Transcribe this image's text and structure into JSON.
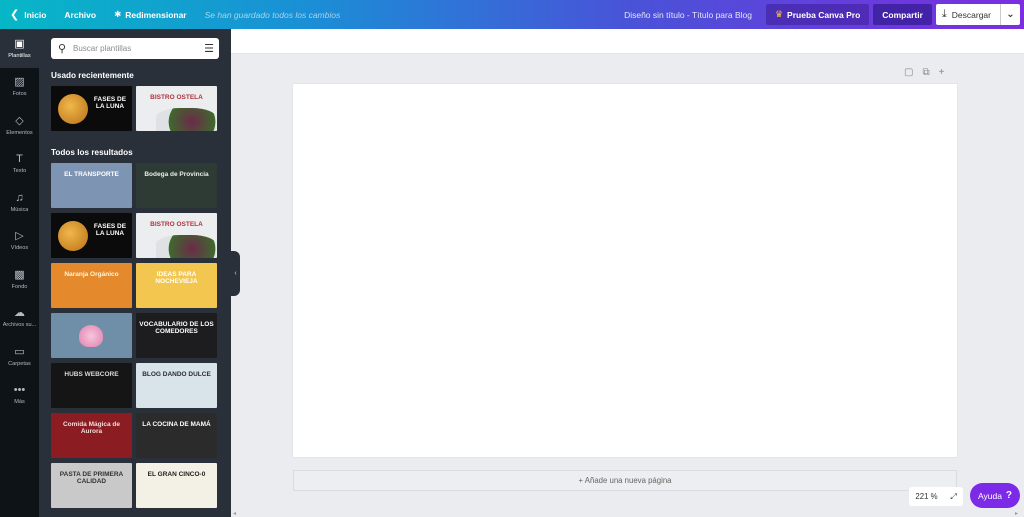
{
  "topbar": {
    "home_label": "Inicio",
    "file_label": "Archivo",
    "resize_label": "Redimensionar",
    "saved_status": "Se han guardado todos los cambios",
    "doc_title": "Diseño sin título - Título para Blog",
    "pro_label": "Prueba Canva Pro",
    "share_label": "Compartir",
    "download_label": "Descargar"
  },
  "rail": {
    "items": [
      {
        "label": "Plantillas",
        "icon": "▣"
      },
      {
        "label": "Fotos",
        "icon": "▨"
      },
      {
        "label": "Elementos",
        "icon": "◇"
      },
      {
        "label": "Texto",
        "icon": "T"
      },
      {
        "label": "Música",
        "icon": "♫"
      },
      {
        "label": "Vídeos",
        "icon": "▷"
      },
      {
        "label": "Fondo",
        "icon": "▩"
      },
      {
        "label": "Archivos su...",
        "icon": "☁"
      },
      {
        "label": "Carpetas",
        "icon": "▭"
      },
      {
        "label": "Más",
        "icon": "•••"
      }
    ]
  },
  "panel": {
    "search_placeholder": "Buscar plantillas",
    "recent_title": "Usado recientemente",
    "all_title": "Todos los resultados",
    "recent": [
      {
        "text": "FASES DE LA LUNA",
        "bg": "#0b0b0b",
        "fg": "#ffffff",
        "moon": true
      },
      {
        "text": "BISTRO OSTELA",
        "bg": "#ecedef",
        "fg": "#b1333c",
        "food": true
      }
    ],
    "results": [
      {
        "text": "EL TRANSPORTE",
        "bg": "#7d95b3",
        "fg": "#ffffff"
      },
      {
        "text": "Bodega de Provincia",
        "bg": "#2d3b34",
        "fg": "#e8efe9"
      },
      {
        "text": "FASES DE LA LUNA",
        "bg": "#0b0b0b",
        "fg": "#ffffff",
        "moon": true
      },
      {
        "text": "BISTRO OSTELA",
        "bg": "#ecedef",
        "fg": "#b1333c",
        "food": true
      },
      {
        "text": "Naranja Orgánico",
        "bg": "#e58a2c",
        "fg": "#fff6d8"
      },
      {
        "text": "IDEAS PARA NOCHEVIEJA",
        "bg": "#f3c64f",
        "fg": "#ffffff"
      },
      {
        "text": "",
        "bg": "#6f8fa8",
        "fg": "#ffffff",
        "flower": true
      },
      {
        "text": "VOCABULARIO DE LOS COMEDORES",
        "bg": "#1d1d1f",
        "fg": "#ffffff"
      },
      {
        "text": "HUBS WEBCORE",
        "bg": "#151515",
        "fg": "#d8d8d8"
      },
      {
        "text": "BLOG DANDO DULCE",
        "bg": "#d9e3ea",
        "fg": "#2c2c2c"
      },
      {
        "text": "Comida Mágica de Aurora",
        "bg": "#8a1c22",
        "fg": "#f4dcdc"
      },
      {
        "text": "LA COCINA DE MAMÁ",
        "bg": "#2b2b2b",
        "fg": "#ffffff"
      },
      {
        "text": "PASTA DE PRIMERA CALIDAD",
        "bg": "#c9c9c9",
        "fg": "#333333"
      },
      {
        "text": "EL GRAN CINCO-0",
        "bg": "#f3f0e6",
        "fg": "#1c1c1c"
      }
    ]
  },
  "canvas": {
    "add_page_label": "+ Añade una nueva página",
    "zoom_label": "221 %",
    "help_label": "Ayuda",
    "help_mark": "?"
  }
}
